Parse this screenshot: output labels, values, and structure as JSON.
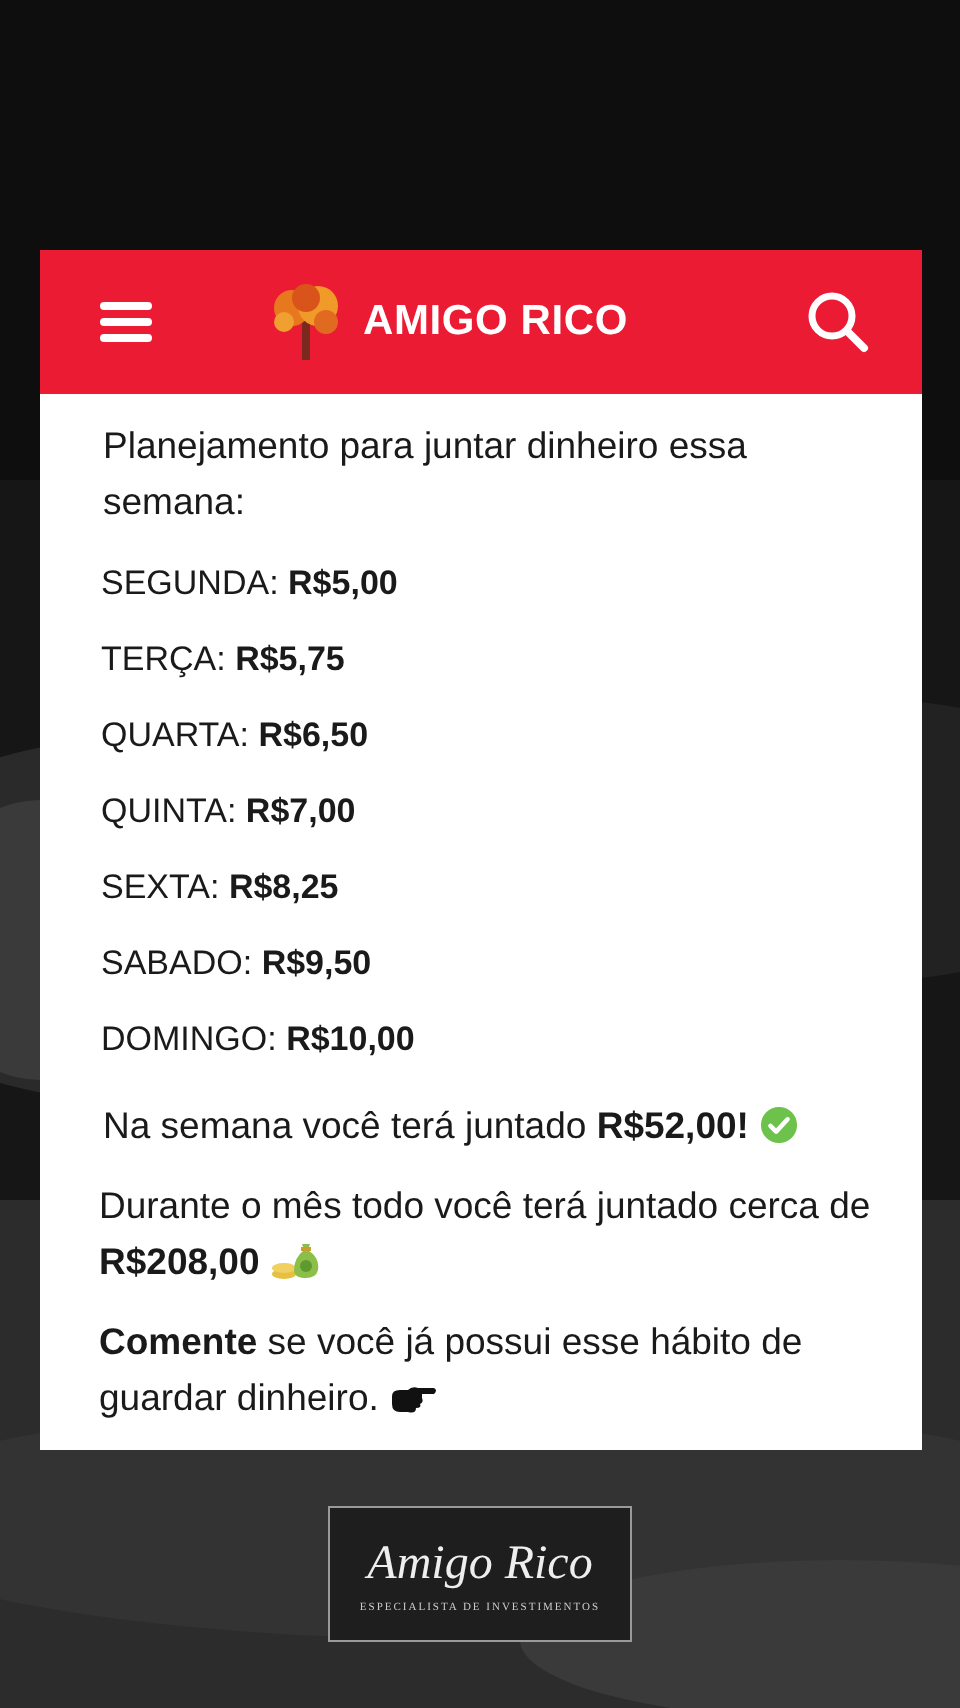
{
  "header": {
    "brand": "AMIGO RICO"
  },
  "intro": "Planejamento para juntar dinheiro essa semana:",
  "days": [
    {
      "text": "SEGUNDA: **R$5,00**"
    },
    {
      "text": "TERÇA: **R$5,75**"
    },
    {
      "text": "QUARTA: **R$6,50**"
    },
    {
      "text": "QUINTA: **R$7,00**"
    },
    {
      "text": "SEXTA: **R$8,25**"
    },
    {
      "text": "SABADO: **R$9,50**"
    },
    {
      "text": "DOMINGO: **R$10,00**"
    }
  ],
  "summary": [
    {
      "text": "Na semana você terá juntado **R$52,00!**",
      "kind": "check"
    },
    {
      "text": "Durante o mês todo você terá juntado cerca de **R$208,00**",
      "kind": "money"
    },
    {
      "text": "**Comente** se você já possui esse hábito de guardar dinheiro.",
      "kind": "point"
    }
  ],
  "logo": {
    "name": "Amigo Rico",
    "tagline": "ESPECIALISTA DE INVESTIMENTOS"
  }
}
